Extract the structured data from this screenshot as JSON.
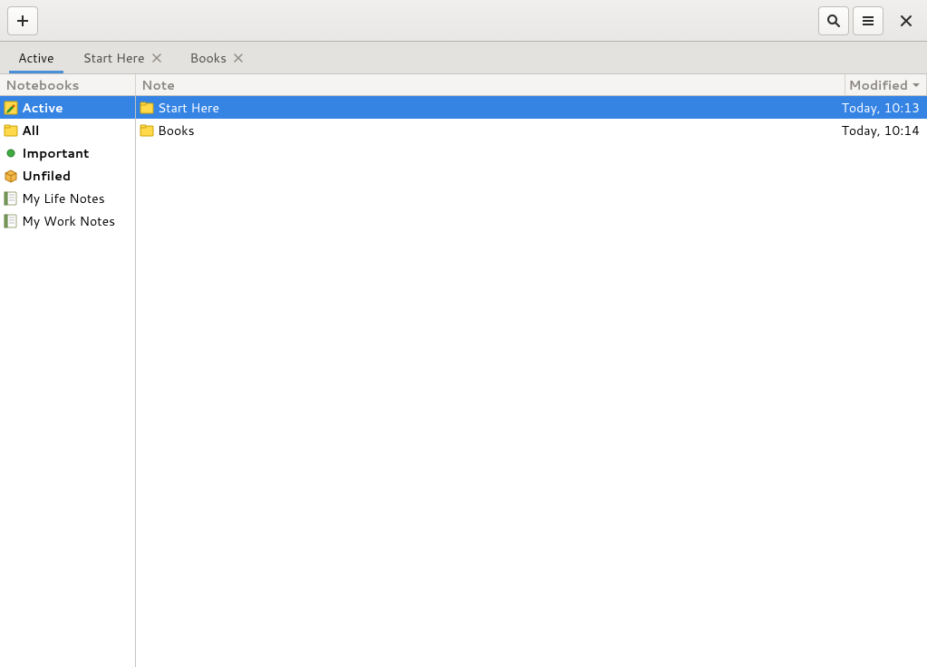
{
  "tabs": [
    {
      "label": "Active",
      "closable": false,
      "active": true
    },
    {
      "label": "Start Here",
      "closable": true,
      "active": false
    },
    {
      "label": "Books",
      "closable": true,
      "active": false
    }
  ],
  "columns": {
    "notebooks": "Notebooks",
    "note": "Note",
    "modified": "Modified"
  },
  "sidebar": [
    {
      "name": "Active",
      "bold": true,
      "selected": true,
      "icon": "note-edit"
    },
    {
      "name": "All",
      "bold": true,
      "selected": false,
      "icon": "folder"
    },
    {
      "name": "Important",
      "bold": true,
      "selected": false,
      "icon": "green-dot"
    },
    {
      "name": "Unfiled",
      "bold": true,
      "selected": false,
      "icon": "box"
    },
    {
      "name": "My Life Notes",
      "bold": false,
      "selected": false,
      "icon": "notebook"
    },
    {
      "name": "My Work Notes",
      "bold": false,
      "selected": false,
      "icon": "notebook"
    }
  ],
  "notes": [
    {
      "name": "Start Here",
      "modified": "Today, 10:13",
      "selected": true,
      "icon": "folder"
    },
    {
      "name": "Books",
      "modified": "Today, 10:14",
      "selected": false,
      "icon": "folder"
    }
  ]
}
